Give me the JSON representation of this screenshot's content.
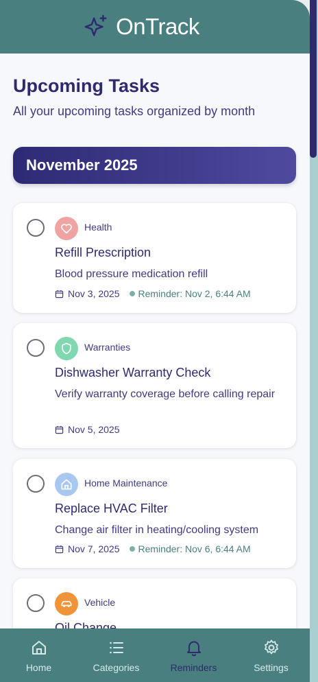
{
  "app": {
    "title": "OnTrack"
  },
  "page": {
    "title": "Upcoming Tasks",
    "subtitle": "All your upcoming tasks organized by month"
  },
  "month": {
    "label": "November 2025"
  },
  "tasks": [
    {
      "category": "Health",
      "title": "Refill Prescription",
      "description": "Blood pressure medication refill",
      "date": "Nov 3, 2025",
      "reminder": "Reminder: Nov 2, 6:44 AM",
      "icon": "heart-icon",
      "icon_color": "#f0a3a3"
    },
    {
      "category": "Warranties",
      "title": "Dishwasher Warranty Check",
      "description": "Verify warranty coverage before calling repair",
      "date": "Nov 5, 2025",
      "reminder": "",
      "icon": "shield-icon",
      "icon_color": "#7fd8b0"
    },
    {
      "category": "Home Maintenance",
      "title": "Replace HVAC Filter",
      "description": "Change air filter in heating/cooling system",
      "date": "Nov 7, 2025",
      "reminder": "Reminder: Nov 6, 6:44 AM",
      "icon": "house-icon",
      "icon_color": "#a9c8f0"
    },
    {
      "category": "Vehicle",
      "title": "Oil Change",
      "icon": "car-icon",
      "icon_color": "#f0943a"
    }
  ],
  "nav": [
    {
      "label": "Home",
      "icon": "home-icon",
      "active": false
    },
    {
      "label": "Categories",
      "icon": "list-icon",
      "active": false
    },
    {
      "label": "Reminders",
      "icon": "bell-icon",
      "active": true
    },
    {
      "label": "Settings",
      "icon": "gear-icon",
      "active": false
    }
  ],
  "colors": {
    "header": "#4a7f80",
    "primary": "#2d2a6e",
    "banner_start": "#2d2a75",
    "banner_end": "#4e4a9e",
    "reminder_dot": "#7fb1ab"
  }
}
